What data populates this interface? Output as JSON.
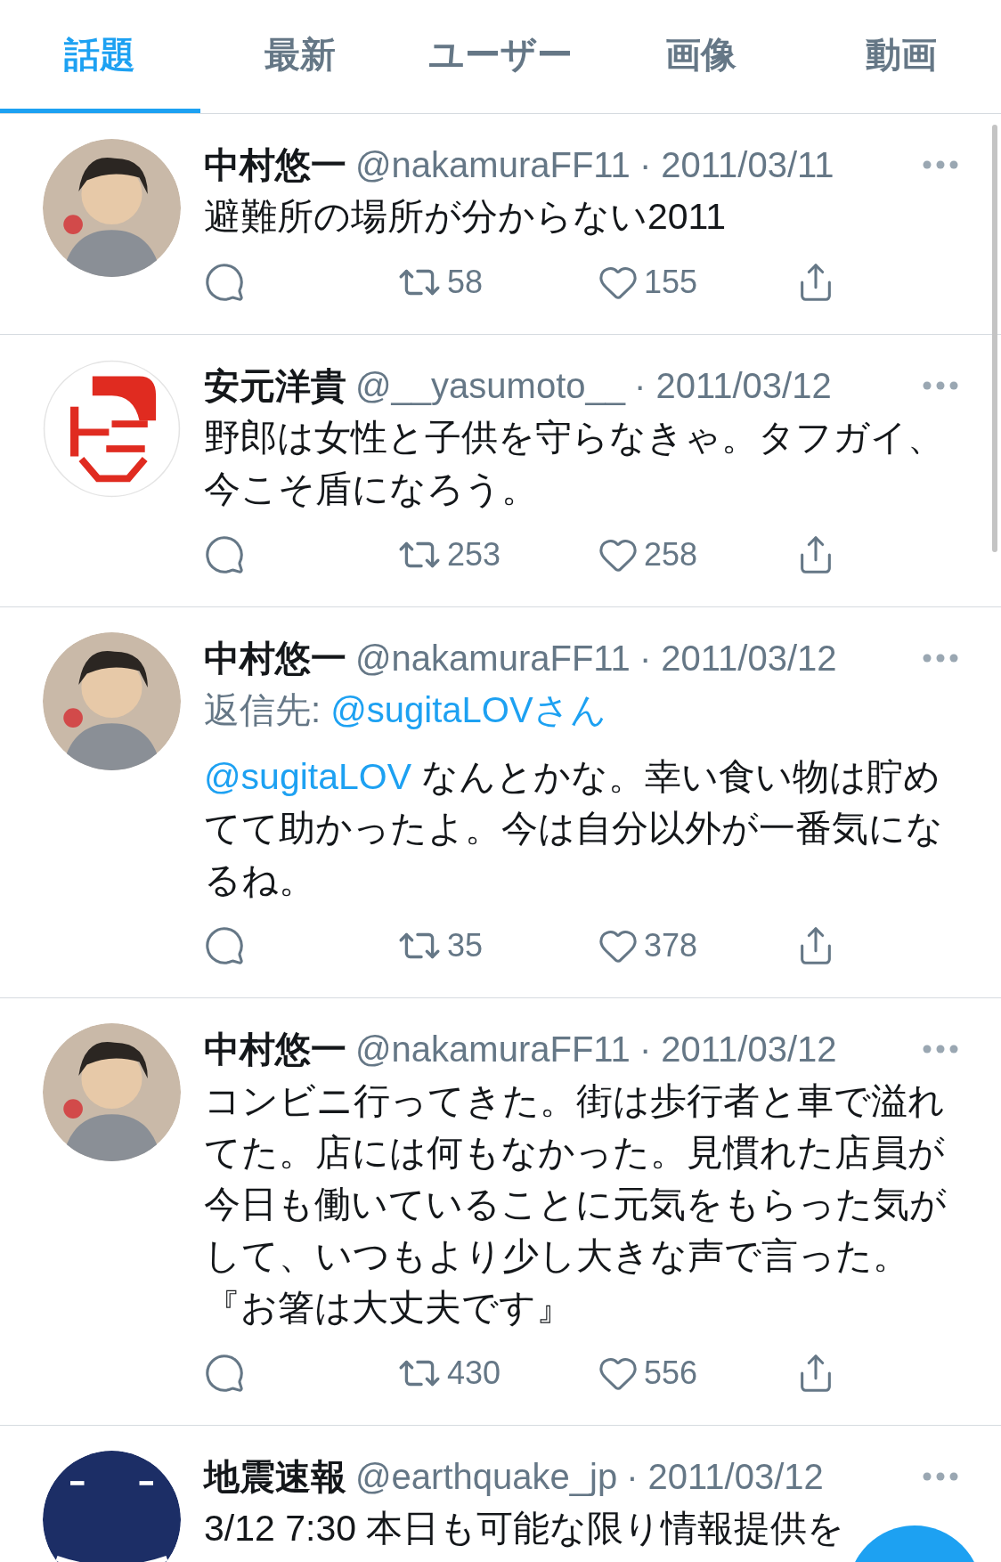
{
  "tabs": [
    {
      "label": "話題",
      "selected": true
    },
    {
      "label": "最新",
      "selected": false
    },
    {
      "label": "ユーザー",
      "selected": false
    },
    {
      "label": "画像",
      "selected": false
    },
    {
      "label": "動画",
      "selected": false
    }
  ],
  "tweets": [
    {
      "avatar": {
        "kind": "portrait"
      },
      "name": "中村悠一",
      "handle": "@nakamuraFF11",
      "date": "· 2011/03/11",
      "text": "避難所の場所が分からない2011",
      "retweets": "58",
      "likes": "155"
    },
    {
      "avatar": {
        "kind": "logo"
      },
      "name": "安元洋貴",
      "handle": "@__yasumoto__",
      "date": "· 2011/03/12",
      "text": "野郎は女性と子供を守らなきゃ。タフガイ、今こそ盾になろう。",
      "retweets": "253",
      "likes": "258"
    },
    {
      "avatar": {
        "kind": "portrait"
      },
      "name": "中村悠一",
      "handle": "@nakamuraFF11",
      "date": "· 2011/03/12",
      "reply_label": "返信先: ",
      "reply_to": "@sugitaLOVさん",
      "mention": "@sugitaLOV",
      "text": " なんとかな。幸い食い物は貯めてて助かったよ。今は自分以外が一番気になるね。",
      "retweets": "35",
      "likes": "378"
    },
    {
      "avatar": {
        "kind": "portrait"
      },
      "name": "中村悠一",
      "handle": "@nakamuraFF11",
      "date": "· 2011/03/12",
      "text": "コンビニ行ってきた。街は歩行者と車で溢れてた。店には何もなかった。見慣れた店員が今日も働いていることに元気をもらった気がして、いつもより少し大きな声で言った。『お箸は大丈夫です』",
      "retweets": "430",
      "likes": "556"
    },
    {
      "avatar": {
        "kind": "badge"
      },
      "name": "地震速報",
      "handle": "@earthquake_jp",
      "date": "· 2011/03/12",
      "text": "3/12 7:30 本日も可能な限り情報提供を"
    }
  ]
}
